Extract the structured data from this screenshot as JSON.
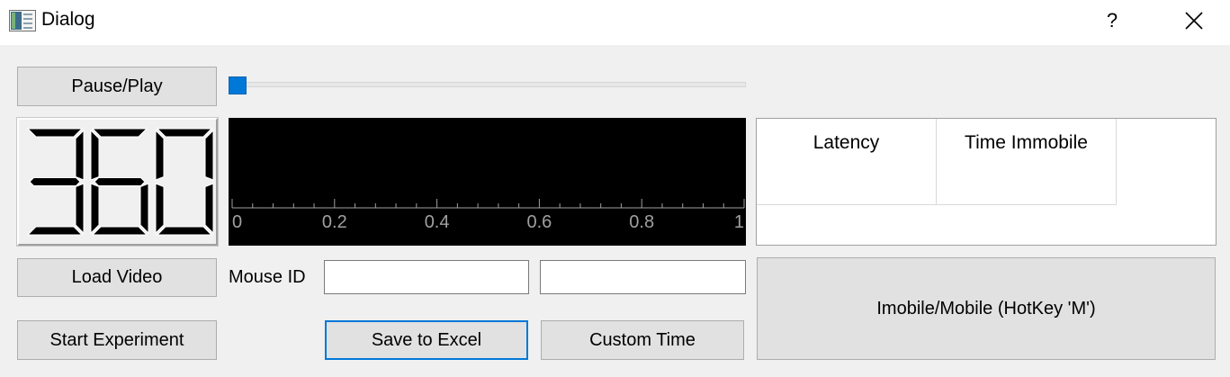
{
  "window": {
    "title": "Dialog",
    "help_glyph": "?",
    "close_glyph": "✕"
  },
  "controls": {
    "pause_play_label": "Pause/Play",
    "load_video_label": "Load Video",
    "start_experiment_label": "Start Experiment",
    "save_to_excel_label": "Save to Excel",
    "custom_time_label": "Custom Time",
    "immobile_label": "Imobile/Mobile (HotKey 'M')",
    "mouse_id_label": "Mouse ID",
    "mouse_id_value": "",
    "second_field_value": ""
  },
  "slider": {
    "value": 0
  },
  "lcd": {
    "value": "360"
  },
  "plot": {
    "tick_labels": [
      "0",
      "0.2",
      "0.4",
      "0.6",
      "0.8",
      "1"
    ],
    "axis_color": "#a0a0a0",
    "background": "#000000"
  },
  "table": {
    "columns": [
      "Latency",
      "Time Immobile"
    ]
  },
  "colors": {
    "accent": "#0078d7",
    "window_bg": "#f0f0f0",
    "button_bg": "#e1e1e1"
  }
}
